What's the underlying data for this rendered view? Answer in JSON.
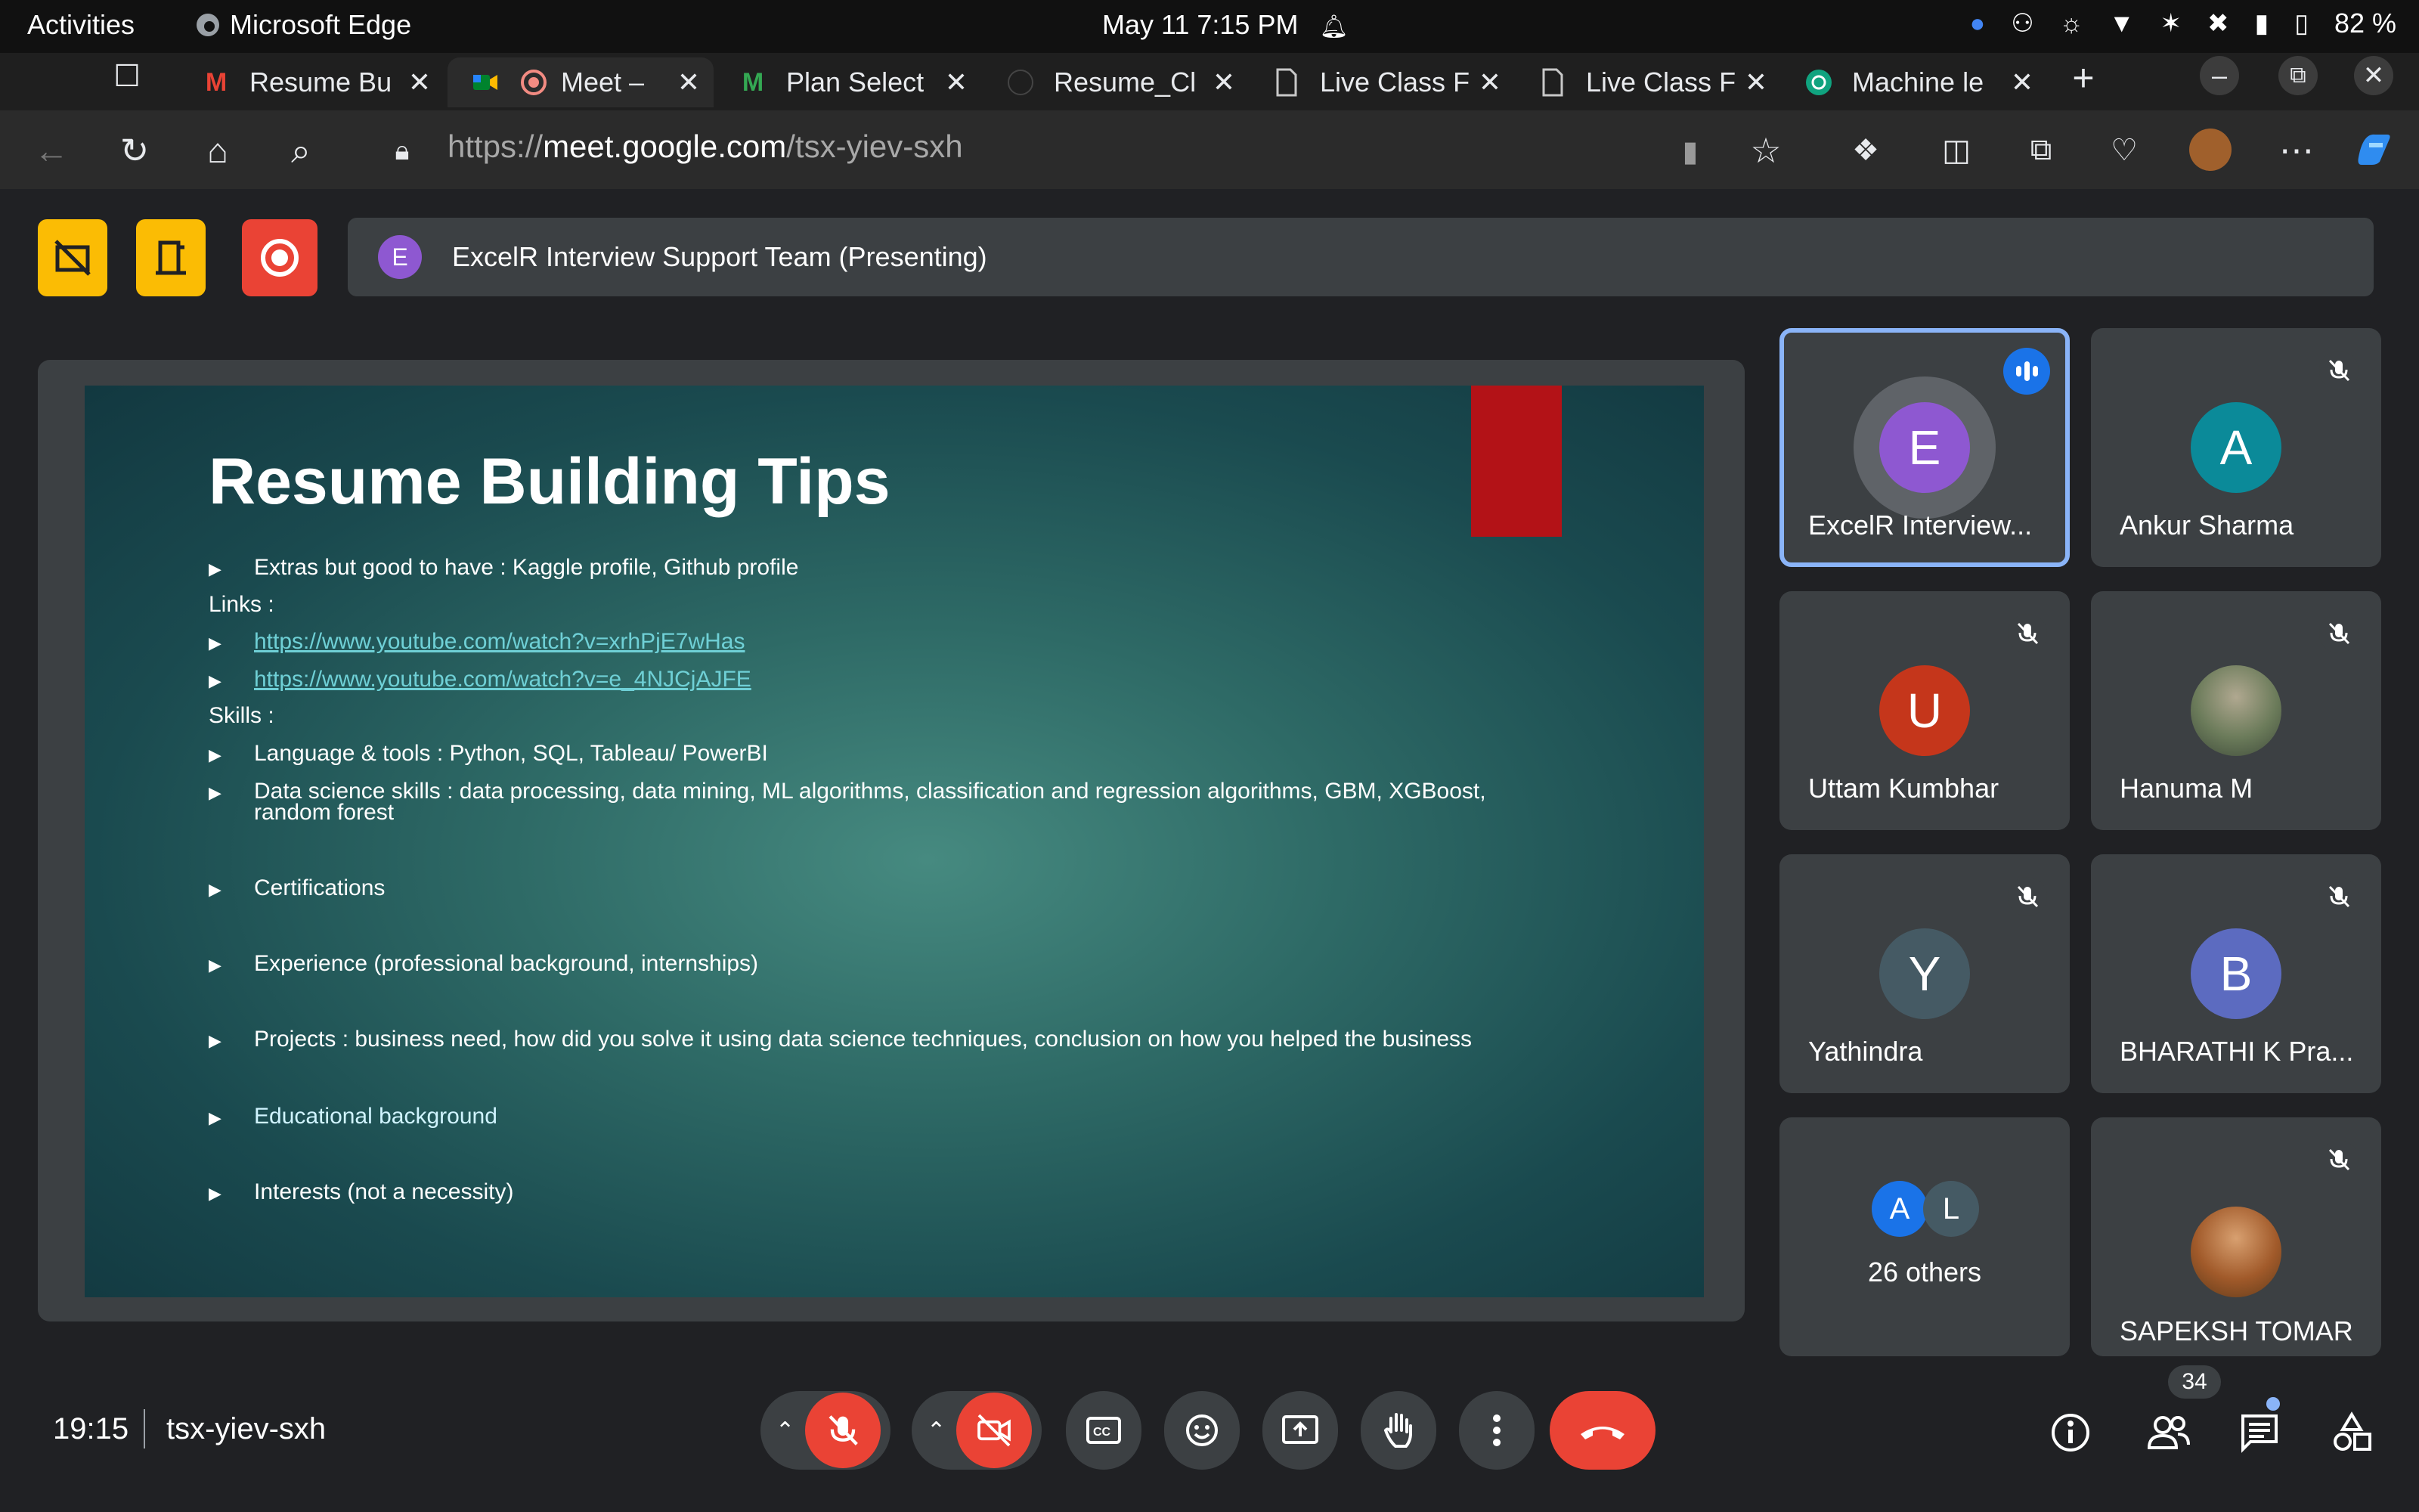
{
  "os": {
    "activities": "Activities",
    "app_name": "Microsoft Edge",
    "datetime": "May 11  7:15 PM",
    "battery": "82 %"
  },
  "tabs": [
    {
      "title": "Resume Bu",
      "icon": "gmail-icon",
      "active": false
    },
    {
      "title": "Meet –",
      "icon": "meet-icon",
      "active": true
    },
    {
      "title": "Plan Select",
      "icon": "m-logo-icon",
      "active": false
    },
    {
      "title": "Resume_Cl",
      "icon": "github-icon",
      "active": false
    },
    {
      "title": "Live Class F",
      "icon": "page-icon",
      "active": false
    },
    {
      "title": "Live Class F",
      "icon": "page-icon",
      "active": false
    },
    {
      "title": "Machine le",
      "icon": "chatgpt-icon",
      "active": false
    }
  ],
  "address": {
    "prefix": "https://",
    "host": "meet.google.com",
    "path": "/tsx-yiev-sxh"
  },
  "presenter_bar": {
    "initial": "E",
    "text": "ExcelR Interview Support Team (Presenting)"
  },
  "slide": {
    "title": "Resume Building Tips",
    "lines": [
      {
        "text": "Extras but good to have : Kaggle profile, Github profile",
        "bullet": true,
        "link": false
      },
      {
        "text": "Links :",
        "bullet": false,
        "link": false
      },
      {
        "text": "https://www.youtube.com/watch?v=xrhPjE7wHas",
        "bullet": true,
        "link": true
      },
      {
        "text": "https://www.youtube.com/watch?v=e_4NJCjAJFE",
        "bullet": true,
        "link": true
      },
      {
        "text": "Skills :",
        "bullet": false,
        "link": false
      },
      {
        "text": "Language & tools : Python, SQL, Tableau/ PowerBI",
        "bullet": true,
        "link": false
      },
      {
        "text": "Data science skills : data processing, data mining, ML algorithms, classification and regression algorithms, GBM, XGBoost,",
        "bullet": true,
        "link": false
      },
      {
        "text": "random forest",
        "bullet": false,
        "link": false
      },
      {
        "text": "Certifications",
        "bullet": true,
        "link": false
      },
      {
        "text": "Experience (professional background, internships)",
        "bullet": true,
        "link": false
      },
      {
        "text": "Projects : business need, how did you solve it using data science techniques, conclusion on how you helped the business",
        "bullet": true,
        "link": false
      },
      {
        "text": "Educational background",
        "bullet": true,
        "link": false
      },
      {
        "text": "Interests (not a necessity)",
        "bullet": true,
        "link": false
      }
    ]
  },
  "participants": [
    {
      "name": "ExcelR Interview...",
      "initial": "E",
      "color": "#8e58d1",
      "speaking": true
    },
    {
      "name": "Ankur Sharma",
      "initial": "A",
      "color": "#0b8a99",
      "speaking": false
    },
    {
      "name": "Uttam Kumbhar",
      "initial": "U",
      "color": "#c5361b",
      "speaking": false
    },
    {
      "name": "Hanuma M",
      "initial": "",
      "color": "#6b7b5a",
      "speaking": false,
      "photo": true
    },
    {
      "name": "Yathindra",
      "initial": "Y",
      "color": "#455a64",
      "speaking": false
    },
    {
      "name": "BHARATHI K Pra...",
      "initial": "B",
      "color": "#5c6bc0",
      "speaking": false
    },
    {
      "name": "SAPEKSH TOMAR",
      "initial": "",
      "color": "#a15a2a",
      "speaking": false,
      "photo": true
    }
  ],
  "others": {
    "label": "26 others",
    "initials": [
      "A",
      "L"
    ],
    "colors": [
      "#1a73e8",
      "#455a64"
    ]
  },
  "bottom": {
    "time": "19:15",
    "meeting_code": "tsx-yiev-sxh",
    "participant_count": "34"
  }
}
